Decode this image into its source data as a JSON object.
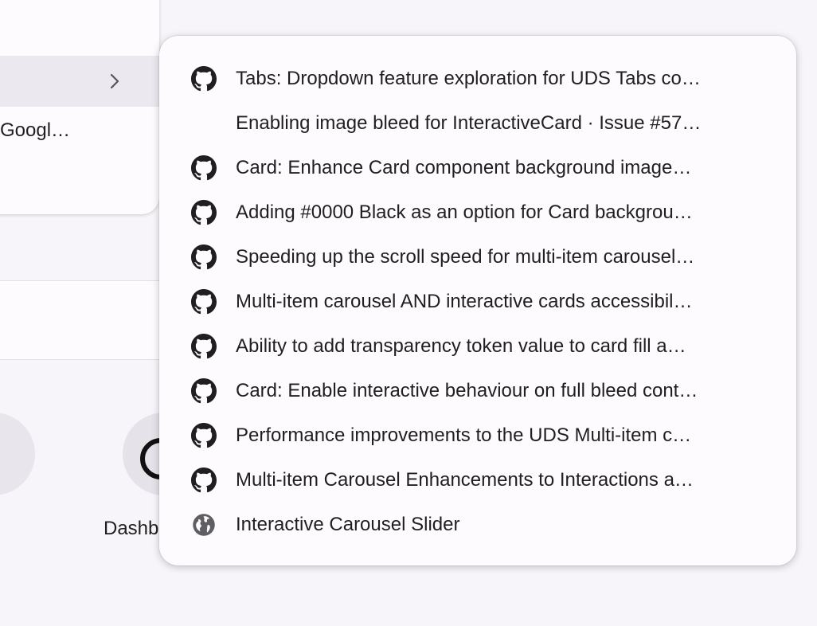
{
  "background": {
    "menu_partial_label": "Googl…",
    "tile_partial_label": "Dashb"
  },
  "dropdown": {
    "items": [
      {
        "label": "Tabs: Dropdown feature exploration for UDS Tabs co…",
        "icon": "github-icon"
      },
      {
        "label": "Enabling image bleed for InteractiveCard · Issue #57…",
        "icon": "blank-favicon-icon"
      },
      {
        "label": "Card: Enhance Card component background image…",
        "icon": "github-icon"
      },
      {
        "label": "Adding #0000 Black as an option for Card backgrou…",
        "icon": "github-icon"
      },
      {
        "label": "Speeding up the scroll speed for multi-item carousel…",
        "icon": "github-icon"
      },
      {
        "label": "Multi-item carousel AND interactive cards accessibil…",
        "icon": "github-icon"
      },
      {
        "label": "Ability to add transparency token value to card fill a…",
        "icon": "github-icon"
      },
      {
        "label": "Card: Enable interactive behaviour on full bleed cont…",
        "icon": "github-icon"
      },
      {
        "label": "Performance improvements to the UDS Multi-item c…",
        "icon": "github-icon"
      },
      {
        "label": "Multi-item Carousel Enhancements to Interactions a…",
        "icon": "github-icon"
      },
      {
        "label": "Interactive Carousel Slider",
        "icon": "globe-icon"
      }
    ]
  },
  "colors": {
    "background": "#f8f5fa",
    "popup": "#fdfbfe",
    "text": "#1f1f1f",
    "icon": "#1f1f1f"
  }
}
